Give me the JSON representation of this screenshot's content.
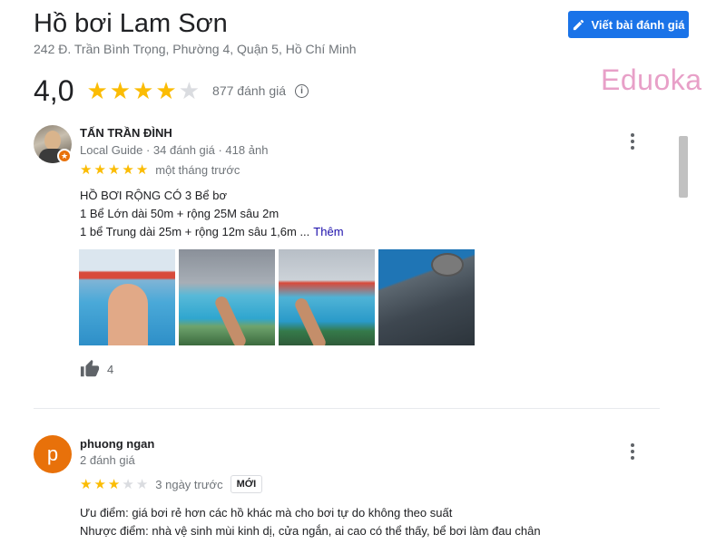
{
  "place": {
    "title": "Hồ bơi Lam Sơn",
    "address": "242 Đ. Trần Bình Trọng, Phường 4, Quận 5, Hồ Chí Minh",
    "rating": "4,0",
    "rating_value": 4,
    "review_count": "877 đánh giá"
  },
  "header": {
    "write_review_label": "Viết bài đánh giá",
    "brand_watermark": "Eduoka"
  },
  "reviews": [
    {
      "name": "TẤN TRẦN ĐÌNH",
      "meta": "Local Guide · 34 đánh giá · 418 ảnh",
      "stars": 5,
      "time": "một tháng trước",
      "text_lines": [
        "HỒ BƠI RỘNG CÓ 3 Bể bơ",
        "1 Bể Lớn dài 50m + rộng 25M sâu 2m",
        "1 bể Trung dài 25m + rộng 12m sâu 1,6m ..."
      ],
      "more_label": "Thêm",
      "likes": "4",
      "photo_count": 4
    },
    {
      "name": "phuong ngan",
      "avatar_letter": "p",
      "meta": "2 đánh giá",
      "stars": 3,
      "time": "3 ngày trước",
      "badge": "MỚI",
      "text_lines": [
        "Ưu điểm: giá bơi rẻ hơn các hồ khác mà cho bơi tự do không theo suất",
        "Nhược điểm: nhà vệ sinh mùi kinh dị, cửa ngắn, ai cao có thể thấy, bể bơi làm đau chân"
      ]
    }
  ],
  "icons": {
    "write": "pencil-icon",
    "info": "info-icon",
    "more": "more-vert-icon",
    "like": "thumbs-up-icon",
    "star": "star-icon"
  },
  "colors": {
    "accent": "#1a73e8",
    "star": "#fbbc04",
    "star_empty": "#dadce0",
    "avatar_orange": "#e8710a",
    "link": "#1a0dab",
    "brand": "#e8a0c8"
  }
}
